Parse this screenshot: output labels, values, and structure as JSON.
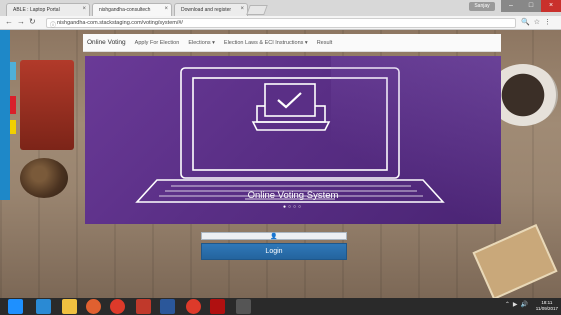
{
  "browser": {
    "tabs": [
      {
        "label": "ABLE : Laptop Portal"
      },
      {
        "label": "nishgandha-consultech"
      },
      {
        "label": "Download and register"
      }
    ],
    "url": "nishgandha-com.stackstaging.com/voting/system/#/",
    "window_user": "Sanjay"
  },
  "site": {
    "brand": "Online Voting",
    "nav": [
      "Apply For Election",
      "Elections ▾",
      "Election Laws & ECI Instructions ▾",
      "Result"
    ]
  },
  "carousel": {
    "caption": "Online Voting System",
    "indicators": "●○○○"
  },
  "login": {
    "username_icon": "user-icon",
    "button_label": "Login"
  },
  "taskbar": {
    "time": "18:11",
    "date": "11/09/2017"
  },
  "colors": {
    "carousel_bg": "#5a2f86",
    "login_button": "#2a6fae",
    "taskbar": "#2a2a2a"
  }
}
